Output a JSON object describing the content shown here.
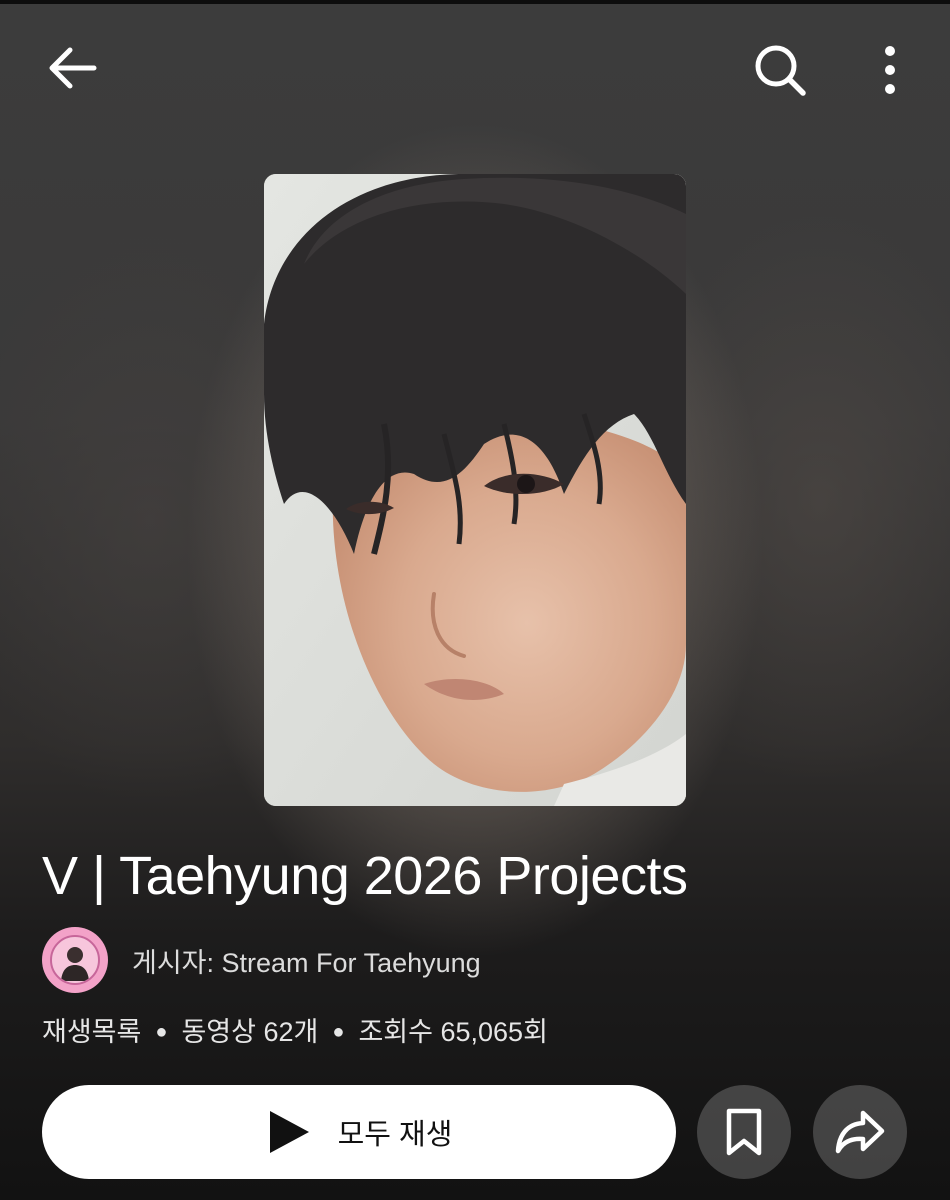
{
  "header": {
    "back_icon": "arrow-left-icon",
    "search_icon": "search-icon",
    "more_icon": "more-vertical-icon"
  },
  "playlist": {
    "title": "V | Taehyung 2026 Projects",
    "author_label": "게시자: Stream For Taehyung",
    "meta": {
      "type": "재생목록",
      "video_count": "동영상 62개",
      "view_count": "조회수 65,065회"
    }
  },
  "actions": {
    "play_all_label": "모두 재생",
    "play_icon": "play-icon",
    "save_icon": "bookmark-icon",
    "share_icon": "share-icon"
  },
  "colors": {
    "play_button_bg": "#ffffff",
    "round_button_bg": "#5a5858",
    "avatar_bg": "#f3a2c8"
  }
}
